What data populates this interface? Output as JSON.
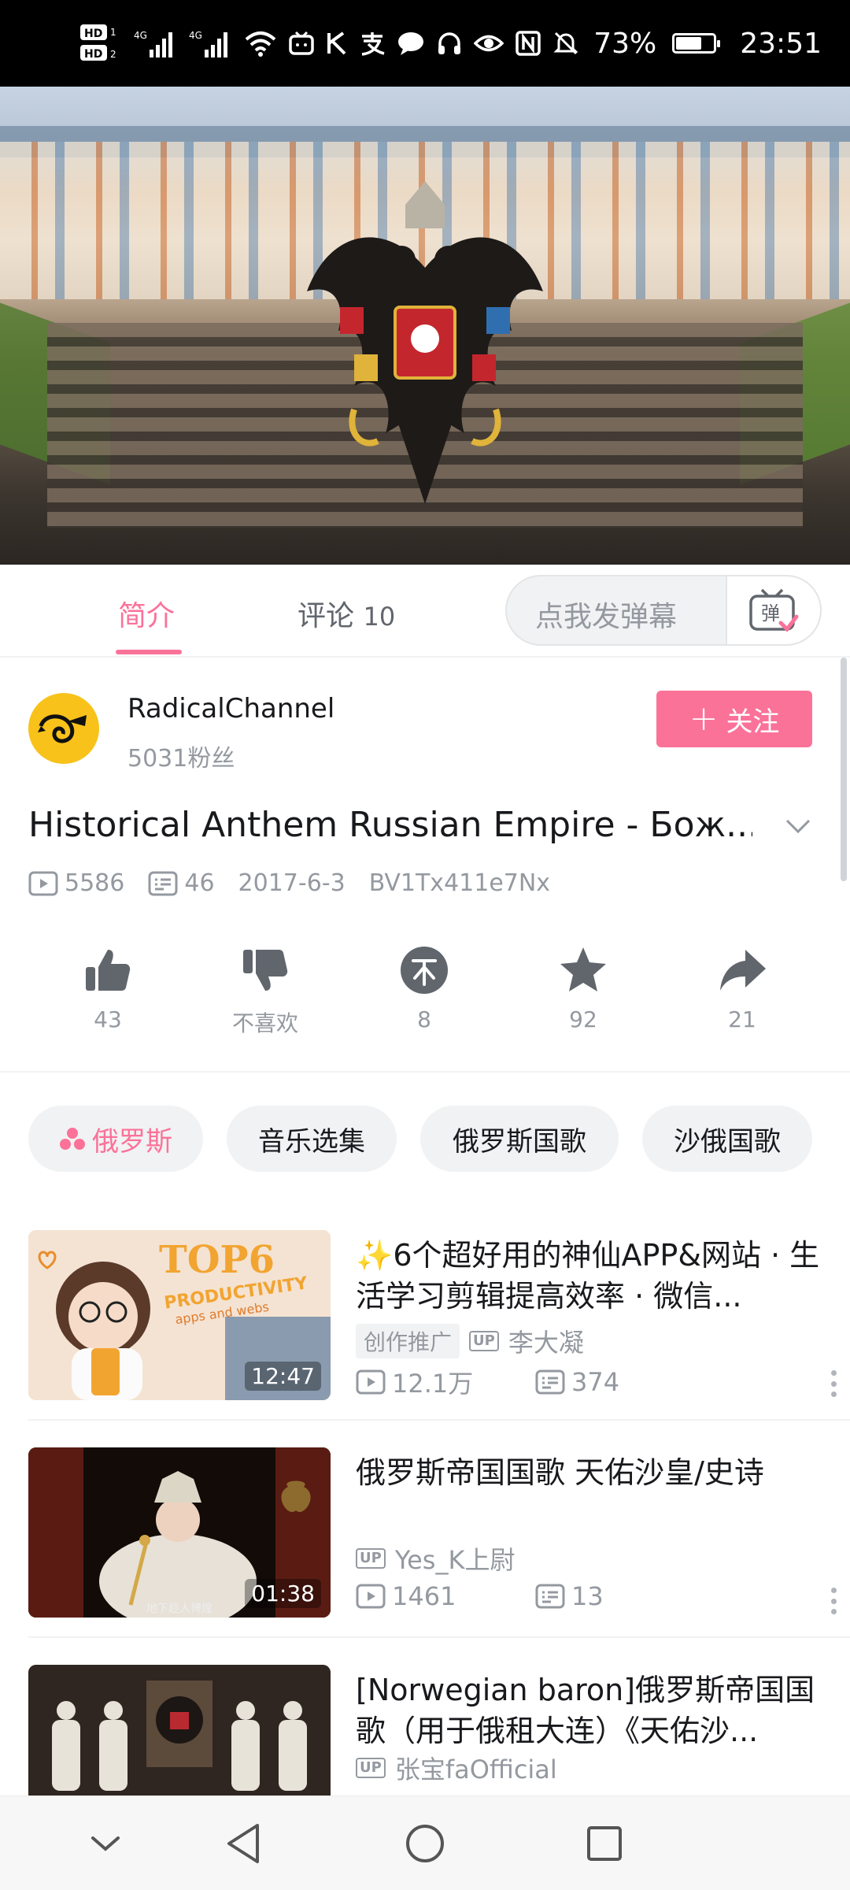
{
  "status_bar": {
    "battery_percent": "73%",
    "time": "23:51",
    "battery_level": 0.73
  },
  "player": {
    "content": "palace-fountain-with-imperial-eagle"
  },
  "tabs": {
    "intro_label": "简介",
    "comments_label": "评论",
    "comments_count": "10",
    "danmaku_placeholder": "点我发弹幕",
    "danmaku_button_icon": "danmaku-tv-icon"
  },
  "uploader": {
    "name": "RadicalChannel",
    "fans": "5031粉丝",
    "follow_label": "关注"
  },
  "video": {
    "title": "Historical Anthem Russian Empire - Бож...",
    "views": "5586",
    "danmaku_count": "46",
    "date": "2017-6-3",
    "bvid": "BV1Tx411e7Nx"
  },
  "actions": {
    "like": "43",
    "dislike": "不喜欢",
    "coin": "8",
    "favorite": "92",
    "share": "21"
  },
  "tags": [
    "俄罗斯",
    "音乐选集",
    "俄罗斯国歌",
    "沙俄国歌"
  ],
  "recommendations": [
    {
      "title": "✨6个超好用的神仙APP&网站 · 生活学习剪辑提高效率 · 微信...",
      "duration": "12:47",
      "badge": "创作推广",
      "up": "李大凝",
      "views": "12.1万",
      "danmaku": "374",
      "thumb_text": "TOP6",
      "thumb_sub": "PRODUCTIVITY",
      "thumb_sub2": "apps and webs"
    },
    {
      "title": "俄罗斯帝国国歌 天佑沙皇/史诗",
      "duration": "01:38",
      "badge": "",
      "up": "Yes_K上尉",
      "views": "1461",
      "danmaku": "13",
      "thumb_caption": "地下趁人博煌"
    },
    {
      "title": "[Norwegian baron]俄罗斯帝国国歌（用于俄租大连）《天佑沙...",
      "duration": "",
      "badge": "",
      "up": "张宝faOfficial",
      "views": "",
      "danmaku": ""
    }
  ],
  "up_mark": "UP",
  "colors": {
    "accent": "#fb7299",
    "text_secondary": "#9499a0",
    "tag_bg": "#f1f2f3"
  }
}
